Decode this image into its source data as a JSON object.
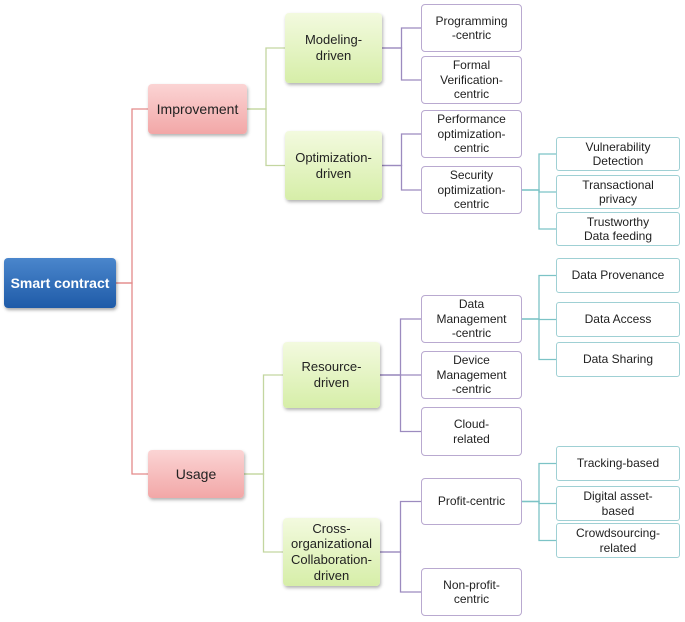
{
  "colors": {
    "root": "#2f6db5",
    "level1": "#f4b3b3",
    "level2": "#dff1b8",
    "level3_border": "#b9a9d0",
    "level4_border": "#9fd0d4",
    "edge_root": "#e38a8a",
    "edge_l1": "#c3d6a0",
    "edge_l2": "#9c8bbf",
    "edge_l3": "#7cc3c6"
  },
  "nodes": [
    {
      "id": "root",
      "label": "Smart contract",
      "parent": null
    },
    {
      "id": "imp",
      "label": "Improvement",
      "parent": "root"
    },
    {
      "id": "use",
      "label": "Usage",
      "parent": "root"
    },
    {
      "id": "mod",
      "label": "Modeling-\ndriven",
      "parent": "imp"
    },
    {
      "id": "opt",
      "label": "Optimization-\ndriven",
      "parent": "imp"
    },
    {
      "id": "res",
      "label": "Resource-\ndriven",
      "parent": "use"
    },
    {
      "id": "cro",
      "label": "Cross-\norganizational\nCollaboration-\ndriven",
      "parent": "use"
    },
    {
      "id": "prog",
      "label": "Programming\n-centric",
      "parent": "mod"
    },
    {
      "id": "form",
      "label": "Formal\nVerification-\ncentric",
      "parent": "mod"
    },
    {
      "id": "perf",
      "label": "Performance\noptimization-\ncentric",
      "parent": "opt"
    },
    {
      "id": "sec",
      "label": "Security\noptimization-\ncentric",
      "parent": "opt"
    },
    {
      "id": "dm",
      "label": "Data\nManagement\n-centric",
      "parent": "res"
    },
    {
      "id": "dev",
      "label": "Device\nManagement\n-centric",
      "parent": "res"
    },
    {
      "id": "cloud",
      "label": "Cloud-\nrelated",
      "parent": "res"
    },
    {
      "id": "profit",
      "label": "Profit-centric",
      "parent": "cro"
    },
    {
      "id": "nonprofit",
      "label": "Non-profit-\ncentric",
      "parent": "cro"
    },
    {
      "id": "vuln",
      "label": "Vulnerability\nDetection",
      "parent": "sec"
    },
    {
      "id": "trans",
      "label": "Transactional\nprivacy",
      "parent": "sec"
    },
    {
      "id": "trust",
      "label": "Trustworthy\nData feeding",
      "parent": "sec"
    },
    {
      "id": "prov",
      "label": "Data Provenance",
      "parent": "dm"
    },
    {
      "id": "access",
      "label": "Data Access",
      "parent": "dm"
    },
    {
      "id": "share",
      "label": "Data Sharing",
      "parent": "dm"
    },
    {
      "id": "track",
      "label": "Tracking-based",
      "parent": "profit"
    },
    {
      "id": "digital",
      "label": "Digital asset-\nbased",
      "parent": "profit"
    },
    {
      "id": "crowd",
      "label": "Crowdsourcing-\nrelated",
      "parent": "profit"
    }
  ]
}
